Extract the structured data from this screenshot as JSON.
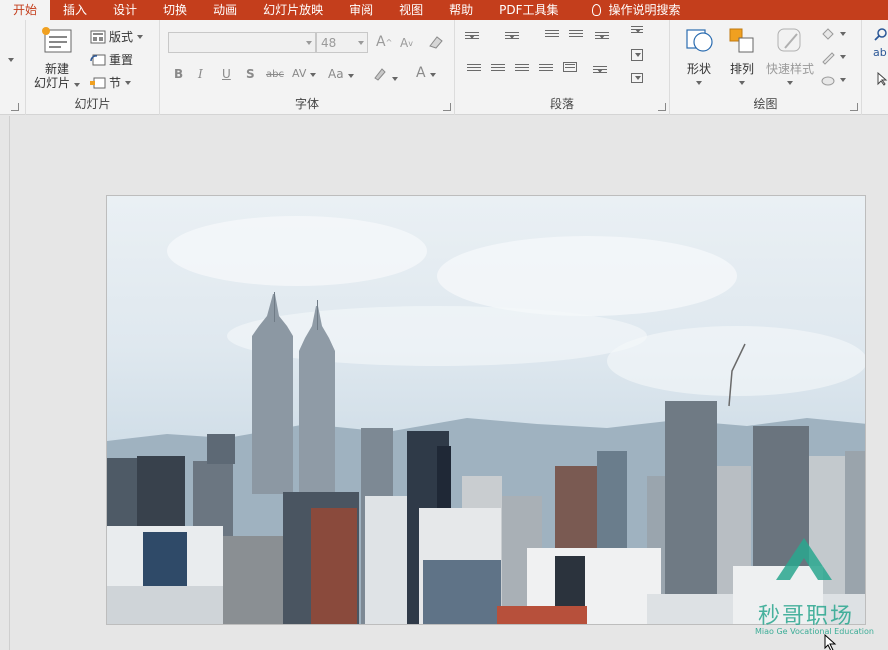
{
  "tabs": [
    {
      "label": "开始",
      "active": true
    },
    {
      "label": "插入"
    },
    {
      "label": "设计"
    },
    {
      "label": "切换"
    },
    {
      "label": "动画"
    },
    {
      "label": "幻灯片放映"
    },
    {
      "label": "审阅"
    },
    {
      "label": "视图"
    },
    {
      "label": "帮助"
    },
    {
      "label": "PDF工具集"
    },
    {
      "label": "操作说明搜索",
      "icon": "lightbulb-icon"
    }
  ],
  "ribbon": {
    "slides": {
      "new_slide_line1": "新建",
      "new_slide_line2": "幻灯片",
      "layout": "版式",
      "reset": "重置",
      "section": "节",
      "group_label": "幻灯片"
    },
    "font": {
      "font_name": "",
      "font_size": "48",
      "bold": "B",
      "italic": "I",
      "underline": "U",
      "shadow": "S",
      "strikethrough": "abc",
      "char_spacing": "AV",
      "change_case": "Aa",
      "font_color": "A",
      "grow": "A",
      "shrink": "A",
      "group_label": "字体"
    },
    "paragraph": {
      "group_label": "段落"
    },
    "drawing": {
      "shapes": "形状",
      "arrange": "排列",
      "quick_styles": "快速样式",
      "group_label": "绘图"
    },
    "editing": {
      "replace_fragment": "ab"
    }
  },
  "watermark": {
    "chinese": "秒哥职场",
    "english": "Miao Ge Vocational Education"
  },
  "colors": {
    "accent": "#c43e1c",
    "ribbon_bg": "#f3f3f3",
    "workspace_bg": "#e6e6e6",
    "watermark": "#2aa78f"
  }
}
